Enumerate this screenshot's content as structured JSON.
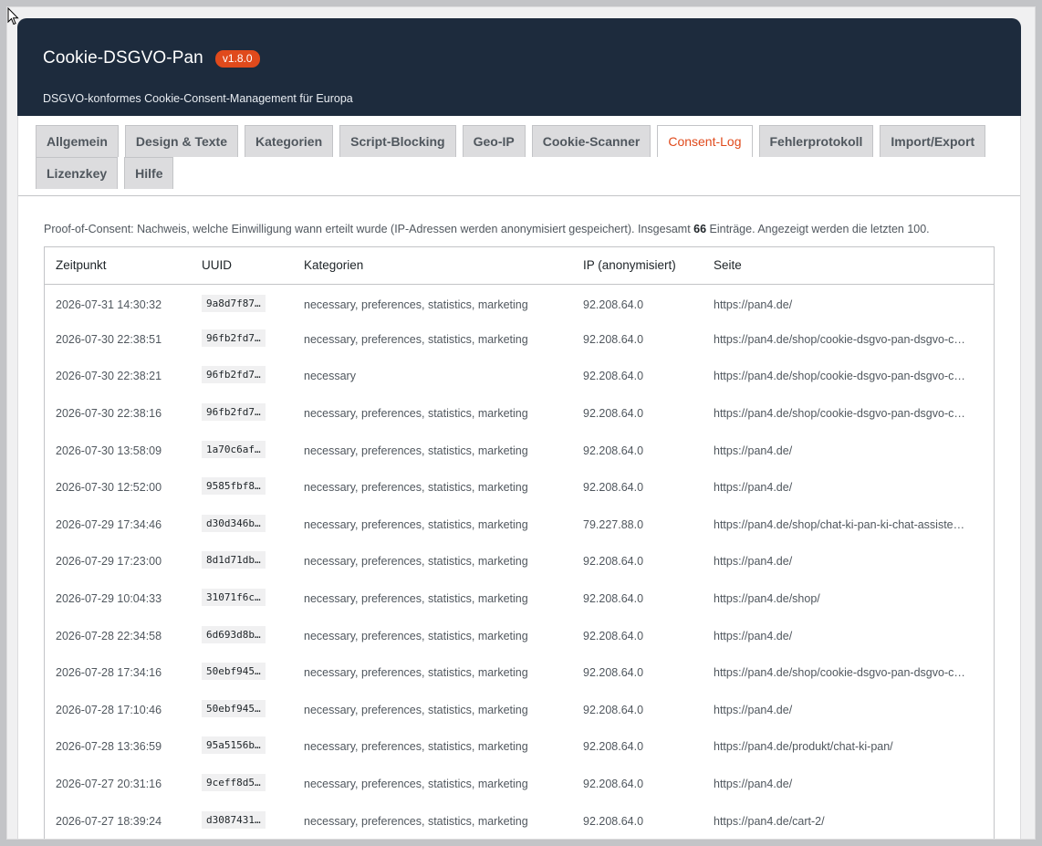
{
  "header": {
    "title": "Cookie-DSGVO-Pan",
    "version": "v1.8.0",
    "subtitle": "DSGVO-konformes Cookie-Consent-Management für Europa"
  },
  "tabs": [
    {
      "label": "Allgemein",
      "active": false
    },
    {
      "label": "Design & Texte",
      "active": false
    },
    {
      "label": "Kategorien",
      "active": false
    },
    {
      "label": "Script-Blocking",
      "active": false
    },
    {
      "label": "Geo-IP",
      "active": false
    },
    {
      "label": "Cookie-Scanner",
      "active": false
    },
    {
      "label": "Consent-Log",
      "active": true
    },
    {
      "label": "Fehlerprotokoll",
      "active": false
    },
    {
      "label": "Import/Export",
      "active": false
    },
    {
      "label": "Lizenzkey",
      "active": false
    },
    {
      "label": "Hilfe",
      "active": false
    }
  ],
  "intro": {
    "before": "Proof-of-Consent: Nachweis, welche Einwilligung wann erteilt wurde (IP-Adressen werden anonymisiert gespeichert). Insgesamt ",
    "count": "66",
    "after": " Einträge. Angezeigt werden die letzten 100."
  },
  "table": {
    "columns": [
      "Zeitpunkt",
      "UUID",
      "Kategorien",
      "IP (anonymisiert)",
      "Seite"
    ],
    "rows": [
      [
        "2026-07-31 14:30:32",
        "9a8d7f87…",
        "necessary, preferences, statistics, marketing",
        "92.208.64.0",
        "https://pan4.de/"
      ],
      [
        "2026-07-30 22:38:51",
        "96fb2fd7…",
        "necessary, preferences, statistics, marketing",
        "92.208.64.0",
        "https://pan4.de/shop/cookie-dsgvo-pan-dsgvo-c…"
      ],
      [
        "2026-07-30 22:38:21",
        "96fb2fd7…",
        "necessary",
        "92.208.64.0",
        "https://pan4.de/shop/cookie-dsgvo-pan-dsgvo-c…"
      ],
      [
        "2026-07-30 22:38:16",
        "96fb2fd7…",
        "necessary, preferences, statistics, marketing",
        "92.208.64.0",
        "https://pan4.de/shop/cookie-dsgvo-pan-dsgvo-c…"
      ],
      [
        "2026-07-30 13:58:09",
        "1a70c6af…",
        "necessary, preferences, statistics, marketing",
        "92.208.64.0",
        "https://pan4.de/"
      ],
      [
        "2026-07-30 12:52:00",
        "9585fbf8…",
        "necessary, preferences, statistics, marketing",
        "92.208.64.0",
        "https://pan4.de/"
      ],
      [
        "2026-07-29 17:34:46",
        "d30d346b…",
        "necessary, preferences, statistics, marketing",
        "79.227.88.0",
        "https://pan4.de/shop/chat-ki-pan-ki-chat-assiste…"
      ],
      [
        "2026-07-29 17:23:00",
        "8d1d71db…",
        "necessary, preferences, statistics, marketing",
        "92.208.64.0",
        "https://pan4.de/"
      ],
      [
        "2026-07-29 10:04:33",
        "31071f6c…",
        "necessary, preferences, statistics, marketing",
        "92.208.64.0",
        "https://pan4.de/shop/"
      ],
      [
        "2026-07-28 22:34:58",
        "6d693d8b…",
        "necessary, preferences, statistics, marketing",
        "92.208.64.0",
        "https://pan4.de/"
      ],
      [
        "2026-07-28 17:34:16",
        "50ebf945…",
        "necessary, preferences, statistics, marketing",
        "92.208.64.0",
        "https://pan4.de/shop/cookie-dsgvo-pan-dsgvo-c…"
      ],
      [
        "2026-07-28 17:10:46",
        "50ebf945…",
        "necessary, preferences, statistics, marketing",
        "92.208.64.0",
        "https://pan4.de/"
      ],
      [
        "2026-07-28 13:36:59",
        "95a5156b…",
        "necessary, preferences, statistics, marketing",
        "92.208.64.0",
        "https://pan4.de/produkt/chat-ki-pan/"
      ],
      [
        "2026-07-27 20:31:16",
        "9ceff8d5…",
        "necessary, preferences, statistics, marketing",
        "92.208.64.0",
        "https://pan4.de/"
      ],
      [
        "2026-07-27 18:39:24",
        "d3087431…",
        "necessary, preferences, statistics, marketing",
        "92.208.64.0",
        "https://pan4.de/cart-2/"
      ]
    ]
  },
  "colors": {
    "header_bg": "#1d2b3d",
    "accent": "#e04a1c"
  }
}
